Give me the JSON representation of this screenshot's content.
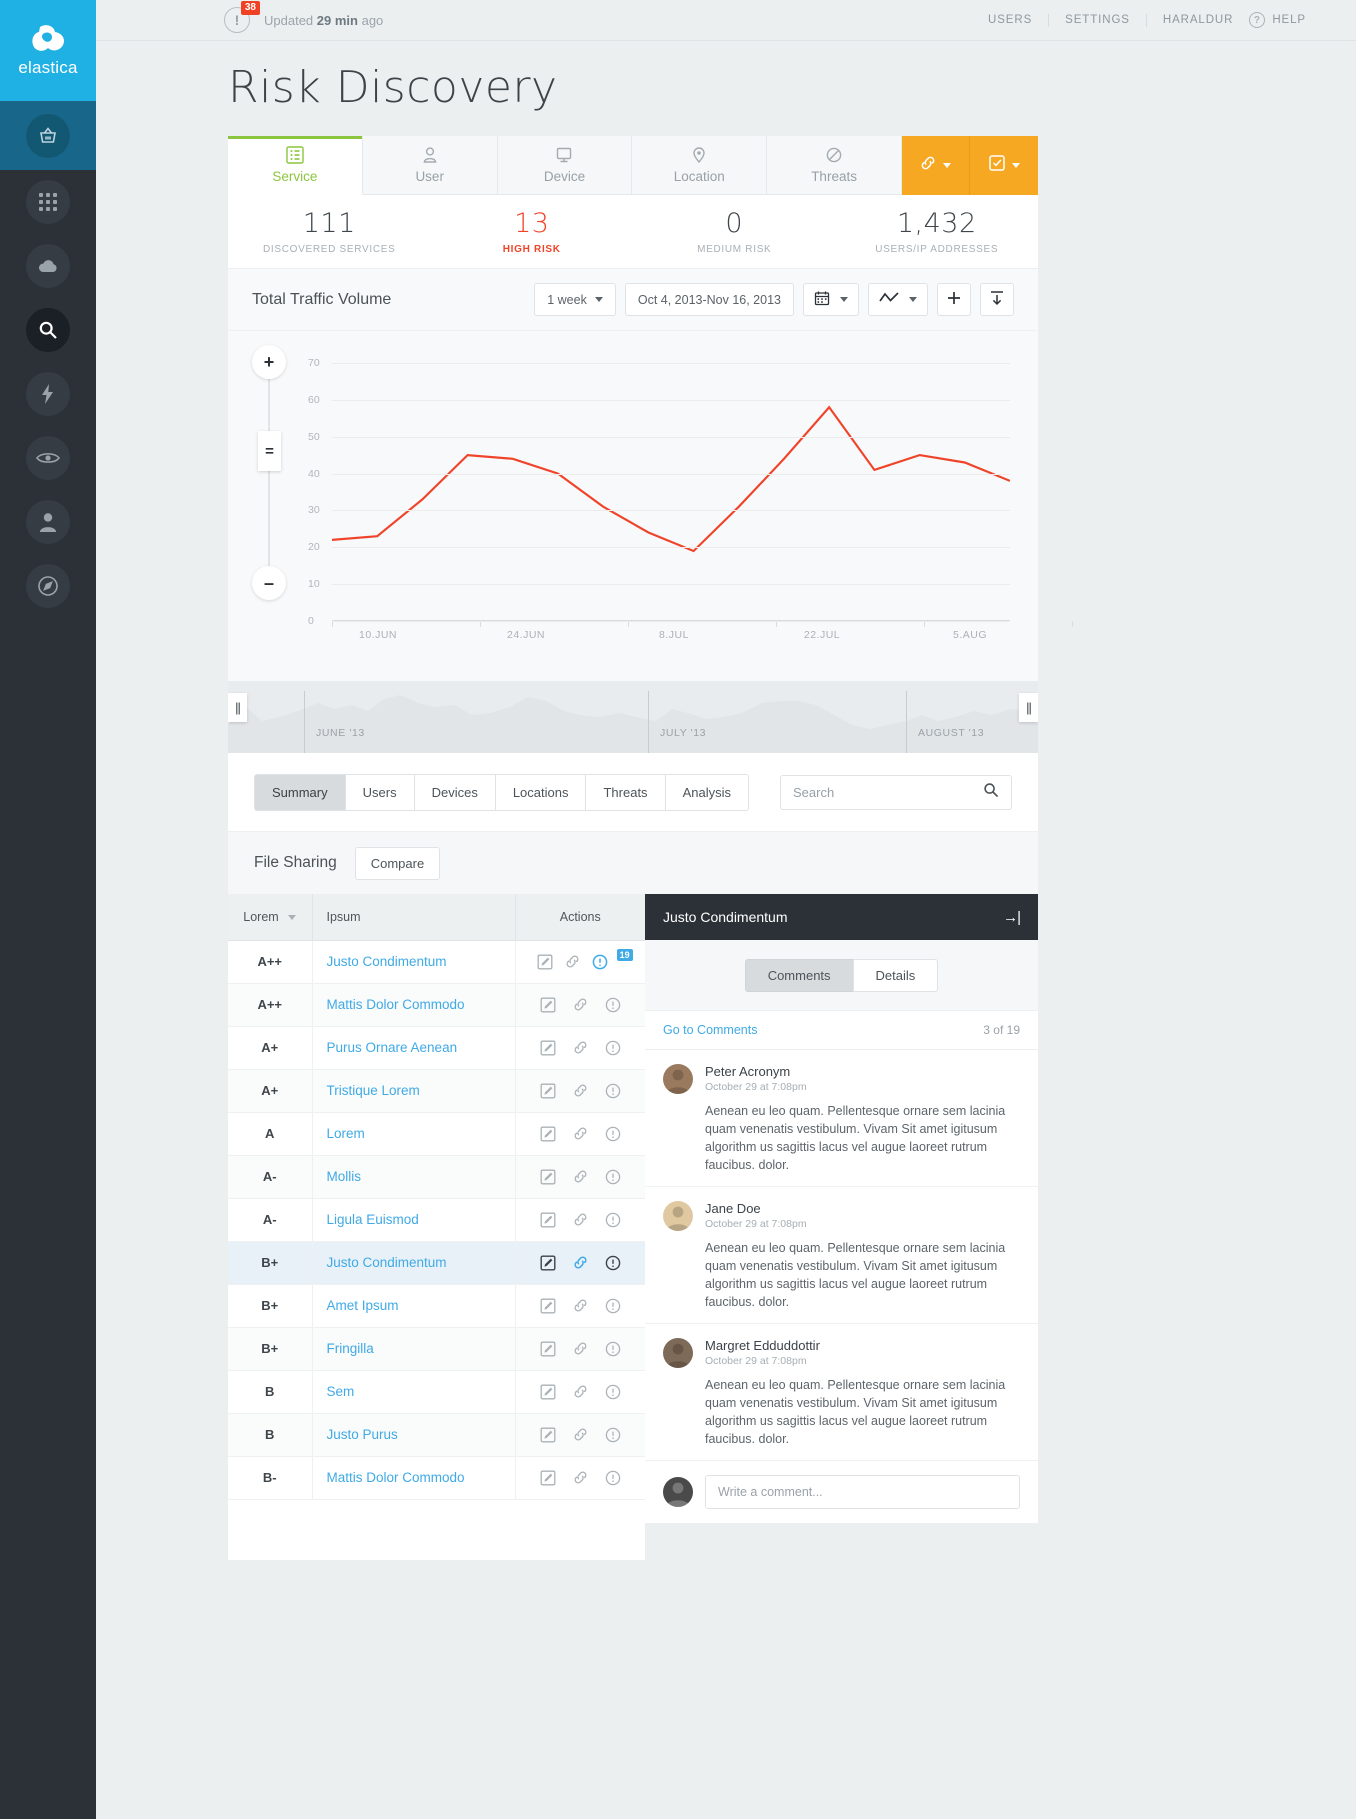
{
  "brand": {
    "name": "elastica"
  },
  "rail": {
    "items": [
      {
        "name": "basket-icon",
        "label": "Discovery"
      },
      {
        "name": "grid-icon",
        "label": "Apps"
      },
      {
        "name": "cloud-icon",
        "label": "Cloud"
      },
      {
        "name": "search-icon",
        "label": "Search"
      },
      {
        "name": "bolt-icon",
        "label": "Activity"
      },
      {
        "name": "eye-icon",
        "label": "Monitor"
      },
      {
        "name": "user-icon",
        "label": "Users"
      },
      {
        "name": "compass-icon",
        "label": "Explore"
      }
    ]
  },
  "topbar": {
    "alert_count": "38",
    "updated_prefix": "Updated",
    "updated_value": "29 min",
    "updated_suffix": "ago",
    "nav": [
      {
        "label": "USERS"
      },
      {
        "label": "SETTINGS"
      },
      {
        "label": "HARALDUR"
      }
    ],
    "help_label": "HELP"
  },
  "page": {
    "title": "Risk Discovery"
  },
  "tabs": [
    {
      "label": "Service",
      "icon": "service-grid-icon",
      "active": true
    },
    {
      "label": "User",
      "icon": "user-icon",
      "active": false
    },
    {
      "label": "Device",
      "icon": "monitor-icon",
      "active": false
    },
    {
      "label": "Location",
      "icon": "pin-icon",
      "active": false
    },
    {
      "label": "Threats",
      "icon": "ban-icon",
      "active": false
    }
  ],
  "tab_buttons": [
    {
      "name": "link-action-button",
      "icon": "link-icon"
    },
    {
      "name": "checklist-action-button",
      "icon": "checkbox-icon"
    }
  ],
  "stats": [
    {
      "value": "111",
      "label": "DISCOVERED SERVICES",
      "danger": false
    },
    {
      "value": "13",
      "label": "HIGH RISK",
      "danger": true
    },
    {
      "value": "0",
      "label": "MEDIUM RISK",
      "danger": false
    },
    {
      "value": "1,432",
      "label": "USERS/IP ADDRESSES",
      "danger": false
    }
  ],
  "chart_panel": {
    "title": "Total Traffic Volume",
    "range_select": "1 week",
    "date_range": "Oct 4, 2013-Nov 16, 2013",
    "calendar_icon": "calendar-icon",
    "chart_type_icon": "line-chart-icon",
    "add_icon": "plus-icon",
    "export_icon": "export-icon"
  },
  "chart_data": {
    "type": "line",
    "title": "Total Traffic Volume",
    "xlabel": "",
    "ylabel": "",
    "ylim": [
      0,
      70
    ],
    "yticks": [
      0,
      10,
      20,
      30,
      40,
      50,
      60,
      70
    ],
    "xlabels": [
      "10.JUN",
      "24.JUN",
      "8.JUL",
      "22.JUL",
      "5.AUG"
    ],
    "grid": true,
    "legend": "none",
    "line_color": "#f0442a",
    "series": [
      {
        "name": "Total Traffic Volume",
        "x": [
          0,
          1,
          2,
          3,
          4,
          5,
          6,
          7,
          8,
          9,
          10,
          11,
          12,
          13,
          14
        ],
        "values": [
          22,
          23,
          33,
          45,
          44,
          40,
          31,
          24,
          19,
          31,
          44,
          58,
          41,
          45,
          43,
          38
        ]
      }
    ]
  },
  "timeline": {
    "months": [
      {
        "label": "JUNE '13"
      },
      {
        "label": "JULY '13"
      },
      {
        "label": "AUGUST '13"
      }
    ],
    "handle_icon": "drag-handle-icon"
  },
  "subtabs": [
    {
      "label": "Summary",
      "active": true
    },
    {
      "label": "Users",
      "active": false
    },
    {
      "label": "Devices",
      "active": false
    },
    {
      "label": "Locations",
      "active": false
    },
    {
      "label": "Threats",
      "active": false
    },
    {
      "label": "Analysis",
      "active": false
    }
  ],
  "search": {
    "placeholder": "Search",
    "value": "",
    "icon": "search-icon"
  },
  "file_sharing": {
    "title": "File Sharing",
    "compare_label": "Compare"
  },
  "table": {
    "columns": [
      "Lorem",
      "Ipsum",
      "Actions"
    ],
    "sort_column": "Lorem",
    "rows": [
      {
        "grade": "A++",
        "name": "Justo Condimentum",
        "badge": "19",
        "selected": false
      },
      {
        "grade": "A++",
        "name": "Mattis Dolor Commodo",
        "badge": "",
        "selected": false
      },
      {
        "grade": "A+",
        "name": "Purus Ornare Aenean",
        "badge": "",
        "selected": false
      },
      {
        "grade": "A+",
        "name": "Tristique Lorem",
        "badge": "",
        "selected": false
      },
      {
        "grade": "A",
        "name": "Lorem",
        "badge": "",
        "selected": false
      },
      {
        "grade": "A-",
        "name": "Mollis",
        "badge": "",
        "selected": false
      },
      {
        "grade": "A-",
        "name": "Ligula Euismod",
        "badge": "",
        "selected": false
      },
      {
        "grade": "B+",
        "name": "Justo Condimentum",
        "badge": "",
        "selected": true
      },
      {
        "grade": "B+",
        "name": "Amet Ipsum",
        "badge": "",
        "selected": false
      },
      {
        "grade": "B+",
        "name": "Fringilla",
        "badge": "",
        "selected": false
      },
      {
        "grade": "B",
        "name": "Sem",
        "badge": "",
        "selected": false
      },
      {
        "grade": "B",
        "name": "Justo Purus",
        "badge": "",
        "selected": false
      },
      {
        "grade": "B-",
        "name": "Mattis Dolor Commodo",
        "badge": "",
        "selected": false
      }
    ],
    "row_action_icons": [
      "edit-icon",
      "link-icon",
      "info-icon"
    ]
  },
  "panel": {
    "title": "Justo Condimentum",
    "collapse_icon": "collapse-right-icon",
    "tabs": [
      {
        "label": "Comments",
        "active": true
      },
      {
        "label": "Details",
        "active": false
      }
    ],
    "goto_label": "Go to Comments",
    "count_label": "3 of 19",
    "comments": [
      {
        "author": "Peter Acronym",
        "date": "October 29 at 7:08pm",
        "text": "Aenean eu leo quam. Pellentesque ornare sem lacinia quam venenatis vestibulum. Vivam Sit amet igitusum algorithm us sagittis lacus vel augue laoreet rutrum faucibus. dolor.",
        "avatar_color": "#9a7a5e"
      },
      {
        "author": "Jane Doe",
        "date": "October 29 at 7:08pm",
        "text": "Aenean eu leo quam. Pellentesque ornare sem lacinia quam venenatis vestibulum. Vivam Sit amet igitusum algorithm us sagittis lacus vel augue laoreet rutrum faucibus. dolor.",
        "avatar_color": "#e0c9a0"
      },
      {
        "author": "Margret Edduddottir",
        "date": "October 29 at 7:08pm",
        "text": "Aenean eu leo quam. Pellentesque ornare sem lacinia quam venenatis vestibulum. Vivam Sit amet igitusum algorithm us sagittis lacus vel augue laoreet rutrum faucibus. dolor.",
        "avatar_color": "#7e6a58"
      }
    ],
    "composer": {
      "placeholder": "Write a comment...",
      "value": "",
      "avatar_color": "#4a4a4a"
    }
  },
  "colors": {
    "brand_blue": "#1fb0e4",
    "accent_green": "#8cc63e",
    "danger_red": "#f0442a",
    "chart_line": "#f0442a",
    "orange_button": "#f7a823",
    "link_blue": "#3faae6",
    "dark": "#2b3137"
  }
}
